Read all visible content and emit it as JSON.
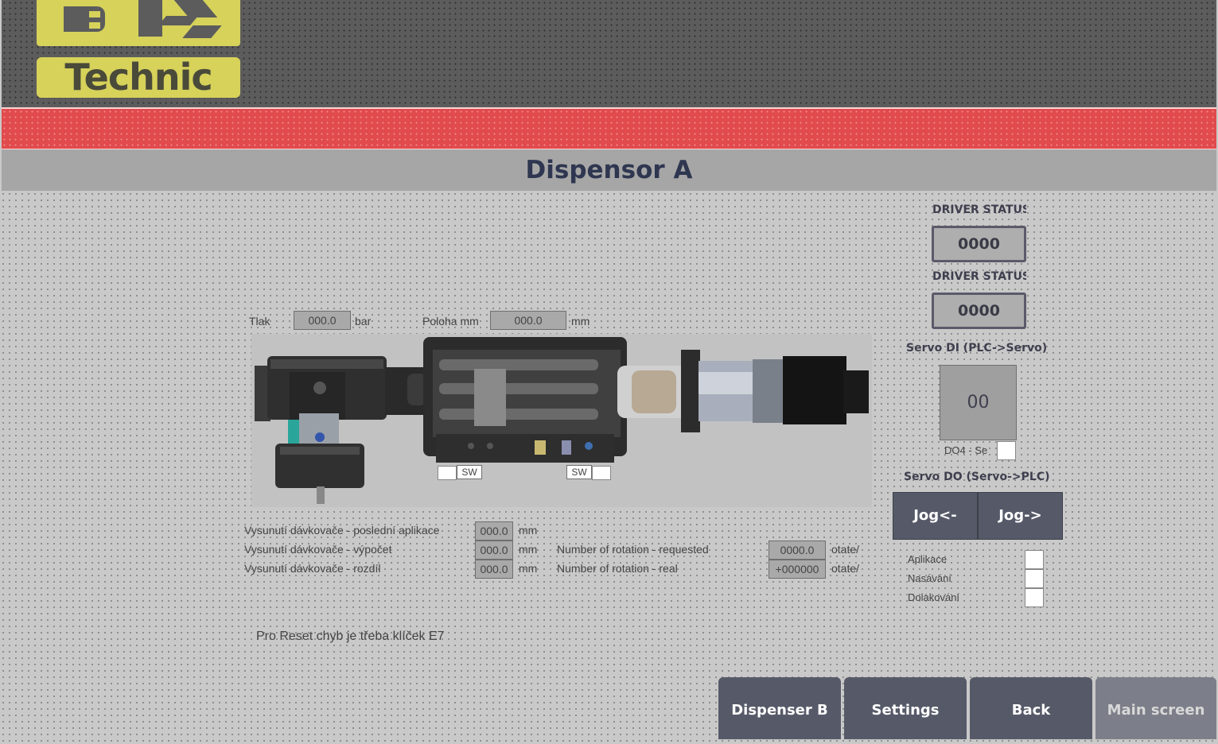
{
  "header": {
    "logo_top": "BK",
    "logo_bottom": "Technic",
    "title": "Dispensor A"
  },
  "colors": {
    "header_bg": "#5c5c5c",
    "logo_yellow": "#d6d25a",
    "alarm_band": "#e14b4d",
    "title_bar": "#a6a6a6",
    "button_bg": "#565a68"
  },
  "readouts": {
    "tlak_label": "Tlak",
    "tlak_value": "000.0",
    "tlak_unit": "bar",
    "poloha_label": "Poloha mm",
    "poloha_value": "000.0",
    "poloha_unit": "mm"
  },
  "machine": {
    "sw_left": "SW",
    "sw_right": "SW"
  },
  "measurements": [
    {
      "label": "Vysunutí dávkovače - poslední aplikace",
      "value": "000.0",
      "unit": "mm"
    },
    {
      "label": "Vysunutí dávkovače - výpočet",
      "value": "000.0",
      "unit": "mm"
    },
    {
      "label": "Vysunutí dávkovače - rozdíl",
      "value": "000.0",
      "unit": "mm"
    }
  ],
  "rotations": [
    {
      "label": "Number of rotation - requested",
      "value": "0000.0",
      "unit": "otate/"
    },
    {
      "label": "Number of rotation - real",
      "value": "+000000",
      "unit": "otate/"
    }
  ],
  "reset_note": "Pro Reset chyb je třeba klíček E7",
  "right_panel": {
    "driver_status_1_label": "DRIVER STATUS",
    "driver_status_1_value": "0000",
    "driver_status_2_label": "DRIVER STATUS",
    "driver_status_2_value": "0000",
    "servo_di_label": "Servo DI (PLC->Servo)",
    "servo_di_value": "00",
    "do4_label": "DO4 - Se",
    "servo_do_label": "Servo DO (Servo->PLC)",
    "jog_left": "Jog<-",
    "jog_right": "Jog->",
    "modes": [
      "Aplikace",
      "Nasávání",
      "Dolakování"
    ]
  },
  "nav": {
    "dispenser_b": "Dispenser B",
    "settings": "Settings",
    "back": "Back",
    "main_screen": "Main screen"
  }
}
